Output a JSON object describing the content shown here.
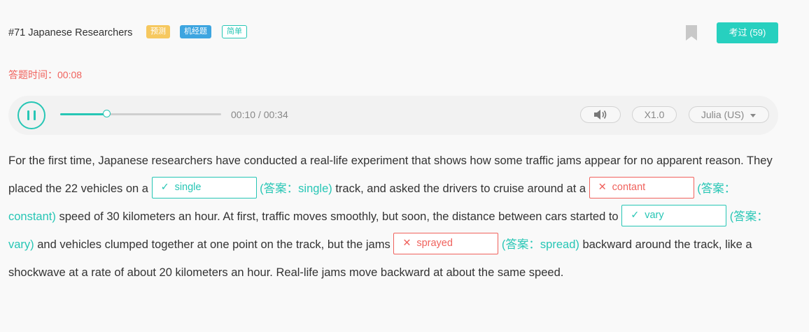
{
  "header": {
    "title": "#71 Japanese Researchers",
    "tags": [
      "预测",
      "机经题",
      "简单"
    ],
    "exam_button": "考过 (59)"
  },
  "timer": "答题时间：00:08",
  "player": {
    "time": "00:10 / 00:34",
    "progress": 0.29,
    "speed": "X1.0",
    "voice": "Julia (US)",
    "accent_color": "#27c6b5"
  },
  "passage": {
    "t1": "For the first time, Japanese researchers have conducted a real-life experiment that shows how some traffic jams appear for no apparent reason. They placed the 22 vehicles on a ",
    "b1": {
      "value": "single",
      "status": "correct",
      "answer": "(答案：single)"
    },
    "t2": " track, and asked the drivers to cruise around at a ",
    "b2": {
      "value": "contant",
      "status": "wrong",
      "answer": "(答案：constant)"
    },
    "t3": " speed of 30 kilometers an hour. At first, traffic moves smoothly, but soon, the distance between cars started to ",
    "b3": {
      "value": "vary",
      "status": "correct",
      "answer": "(答案：vary)"
    },
    "t4": " and vehicles clumped together at one point on the track, but the jams ",
    "b4": {
      "value": "sprayed",
      "status": "wrong",
      "answer": "(答案：spread)"
    },
    "t5": " backward around the track, like a shockwave at a rate of about 20 kilometers an hour. Real-life jams move backward at about the same speed."
  },
  "icons": {
    "play": "pause-icon",
    "volume": "speaker-icon",
    "voice": "caret-down-icon",
    "correct": "check-icon",
    "wrong": "cross-icon",
    "bookmark": "bookmark-icon"
  }
}
